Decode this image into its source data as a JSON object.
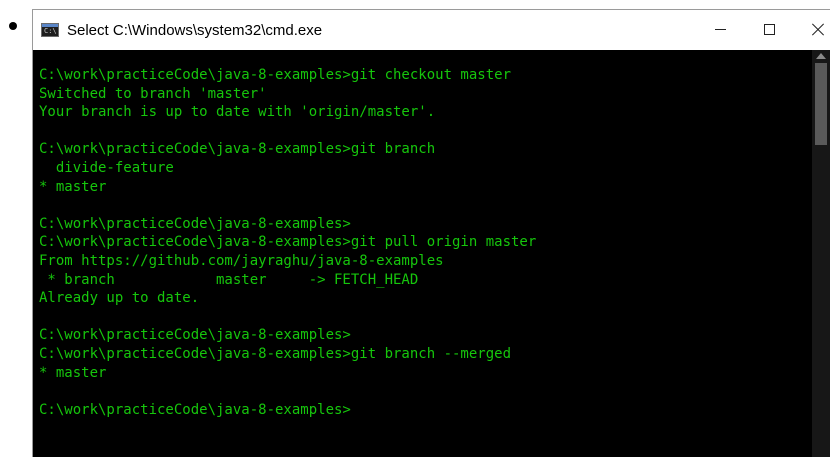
{
  "window": {
    "title": "Select C:\\Windows\\system32\\cmd.exe",
    "icon": "cmd-icon",
    "icon_glyph": "C:\\"
  },
  "controls": {
    "minimize": "minimize-icon",
    "maximize": "maximize-icon",
    "close": "close-icon"
  },
  "console": {
    "text_color": "#16c60c",
    "background": "#000000",
    "lines": [
      "C:\\work\\practiceCode\\java-8-examples>git checkout master",
      "Switched to branch 'master'",
      "Your branch is up to date with 'origin/master'.",
      "",
      "C:\\work\\practiceCode\\java-8-examples>git branch",
      "  divide-feature",
      "* master",
      "",
      "C:\\work\\practiceCode\\java-8-examples>",
      "C:\\work\\practiceCode\\java-8-examples>git pull origin master",
      "From https://github.com/jayraghu/java-8-examples",
      " * branch            master     -> FETCH_HEAD",
      "Already up to date.",
      "",
      "C:\\work\\practiceCode\\java-8-examples>",
      "C:\\work\\practiceCode\\java-8-examples>git branch --merged",
      "* master",
      "",
      "C:\\work\\practiceCode\\java-8-examples>"
    ]
  }
}
